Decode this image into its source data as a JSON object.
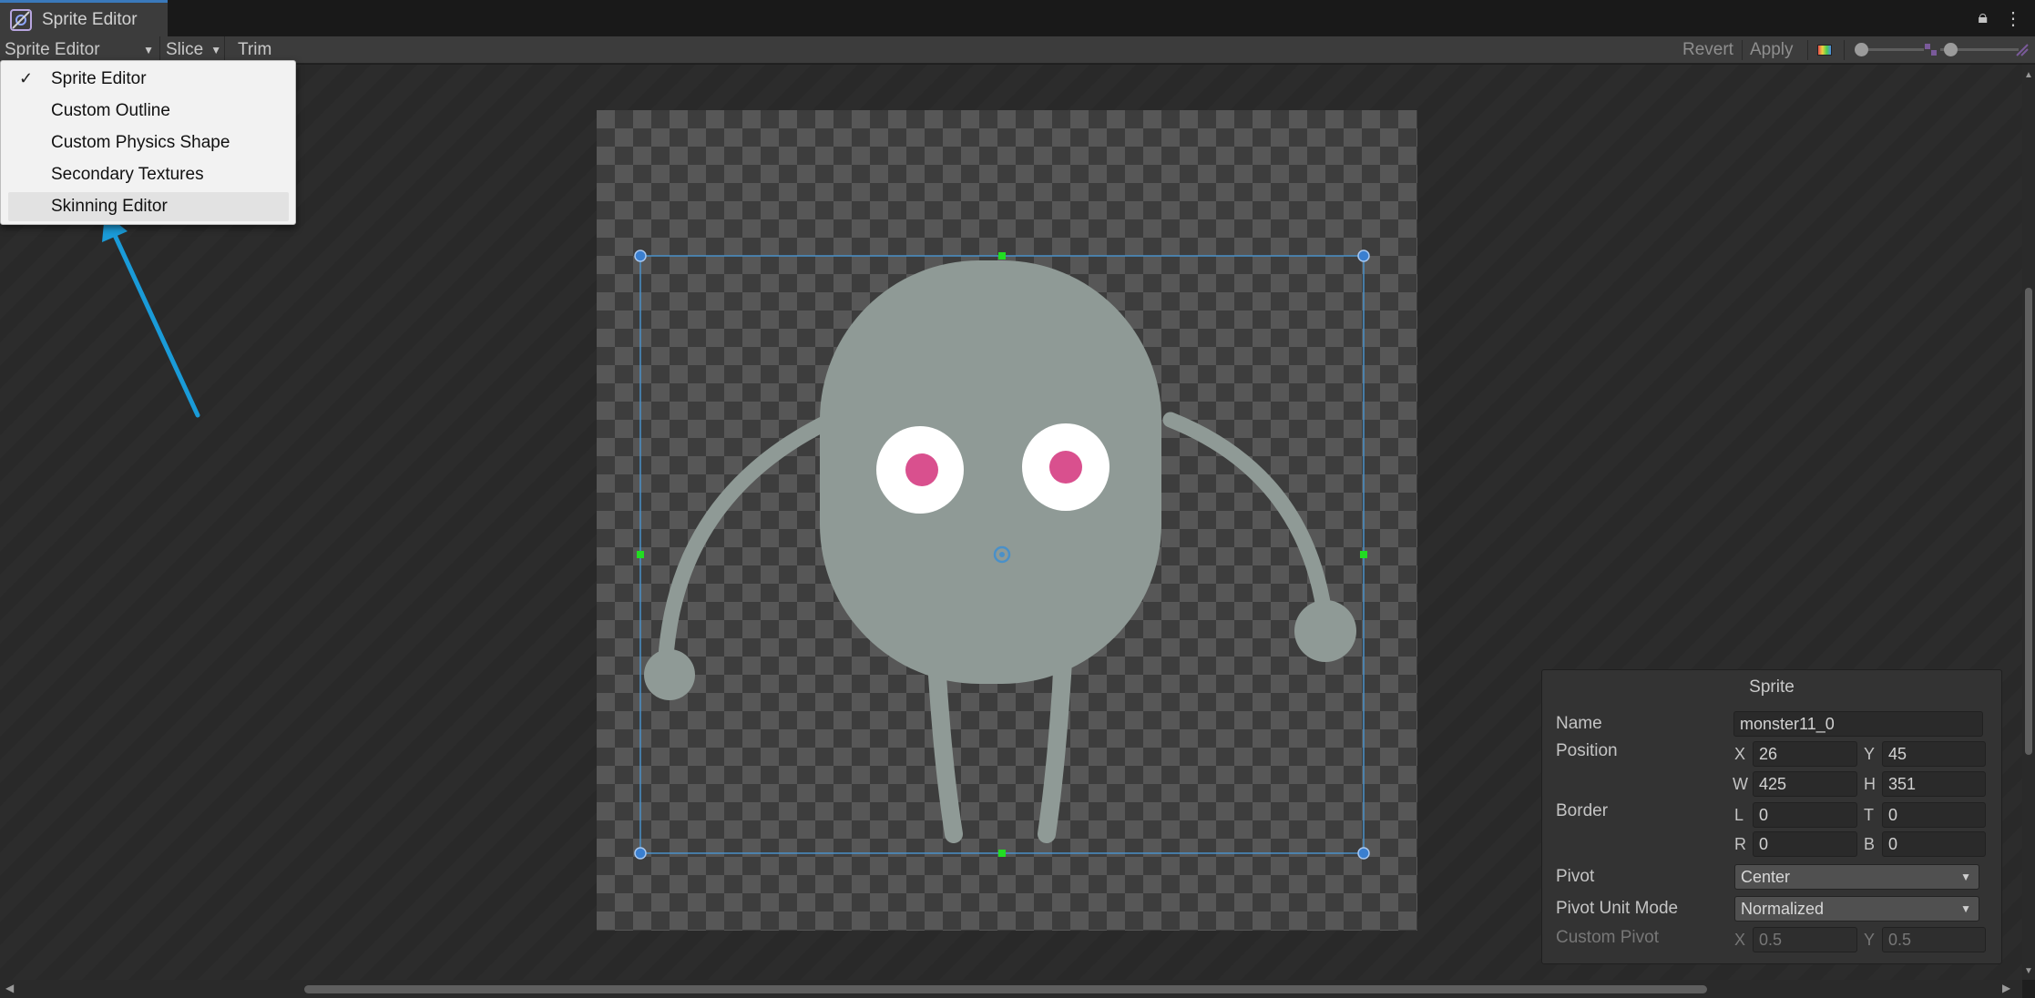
{
  "window": {
    "tab_title": "Sprite Editor",
    "icons": [
      "lock-icon",
      "kebab-menu-icon"
    ]
  },
  "toolbar": {
    "mode_select_label": "Sprite Editor",
    "slice_label": "Slice",
    "trim_label": "Trim",
    "revert_label": "Revert",
    "apply_label": "Apply"
  },
  "mode_menu": {
    "items": [
      {
        "label": "Sprite Editor",
        "checked": true
      },
      {
        "label": "Custom Outline",
        "checked": false
      },
      {
        "label": "Custom Physics Shape",
        "checked": false
      },
      {
        "label": "Secondary Textures",
        "checked": false
      },
      {
        "label": "Skinning Editor",
        "checked": false,
        "highlighted": true
      }
    ]
  },
  "sprite_panel": {
    "title": "Sprite",
    "name_label": "Name",
    "name_value": "monster11_0",
    "position_label": "Position",
    "x_label": "X",
    "x_value": "26",
    "y_label": "Y",
    "y_value": "45",
    "w_label": "W",
    "w_value": "425",
    "h_label": "H",
    "h_value": "351",
    "border_label": "Border",
    "l_label": "L",
    "l_value": "0",
    "t_label": "T",
    "t_value": "0",
    "r_label": "R",
    "r_value": "0",
    "b_label": "B",
    "b_value": "0",
    "pivot_label": "Pivot",
    "pivot_value": "Center",
    "pivot_unit_label": "Pivot Unit Mode",
    "pivot_unit_value": "Normalized",
    "custom_pivot_label": "Custom Pivot",
    "cp_x_label": "X",
    "cp_x_value": "0.5",
    "cp_y_label": "Y",
    "cp_y_value": "0.5"
  },
  "colors": {
    "accent": "#3a79bb",
    "selection_outline": "#4a90c8",
    "handle_green": "#22dd22",
    "annotation_arrow": "#1a9bd8"
  }
}
